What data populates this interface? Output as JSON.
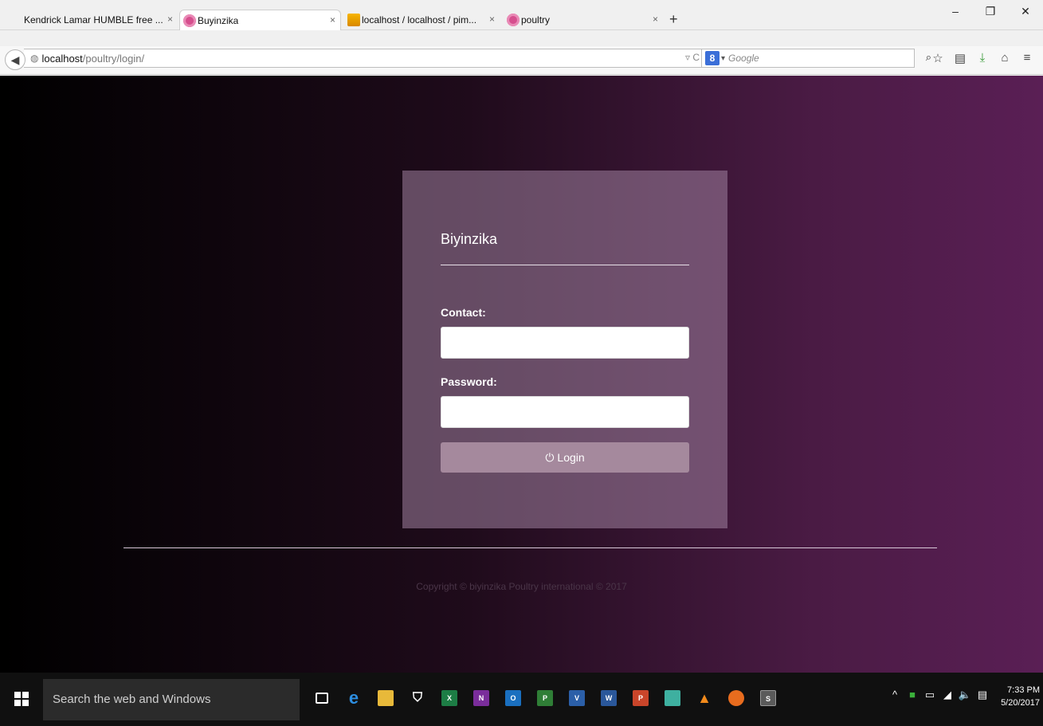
{
  "browser": {
    "tabs": [
      {
        "label": "Kendrick Lamar HUMBLE free ...",
        "close": "×"
      },
      {
        "label": "Buyinzika",
        "close": "×"
      },
      {
        "label": "localhost / localhost / pim...",
        "close": "×"
      },
      {
        "label": "poultry",
        "close": "×"
      }
    ],
    "new_tab": "+",
    "window_controls": {
      "minimize": "–",
      "restore": "❐",
      "close": "✕"
    },
    "url": {
      "host": "localhost",
      "path": "/poultry/login/"
    },
    "search": {
      "engine": "8",
      "placeholder": "Google"
    }
  },
  "page": {
    "brand": "Biyinzika",
    "contact_label": "Contact:",
    "password_label": "Password:",
    "contact_value": "",
    "password_value": "",
    "login_button": "Login",
    "copyright": "Copyright © biyinzika Poultry international © 2017",
    "colors": {
      "bg_start": "#000000",
      "bg_end": "#5a1f55",
      "card": "#a082a0",
      "button": "#a5899d"
    }
  },
  "taskbar": {
    "search_placeholder": "Search the web and Windows",
    "time": "7:33 PM",
    "date": "5/20/2017",
    "apps": [
      "task-view",
      "edge",
      "file-explorer",
      "store",
      "excel",
      "onenote",
      "outlook",
      "project",
      "visio",
      "word",
      "powerpoint",
      "gallery",
      "vlc",
      "firefox",
      "sublime"
    ]
  }
}
